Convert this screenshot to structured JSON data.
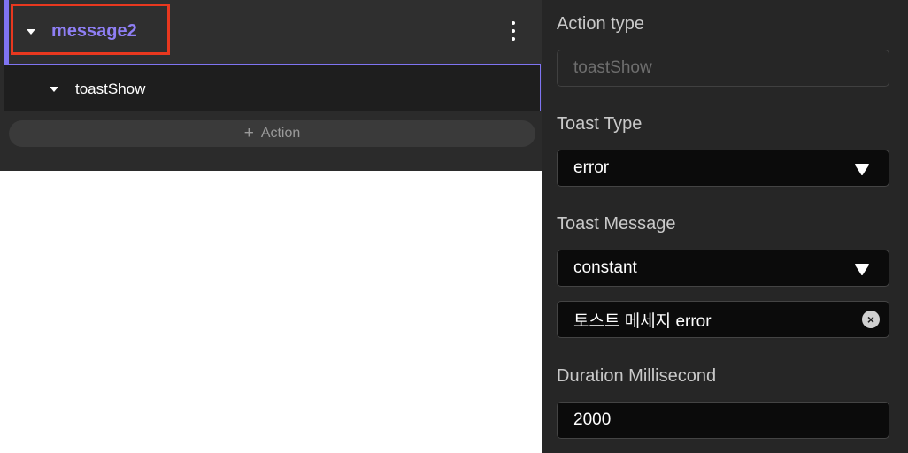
{
  "event": {
    "name": "message2",
    "menu_icon": "kebab-icon",
    "expand_icon": "caret-down-icon"
  },
  "action": {
    "name": "toastShow",
    "expand_icon": "caret-down-icon"
  },
  "add_action": {
    "plus": "+",
    "label": "Action"
  },
  "panel": {
    "action_type": {
      "label": "Action type",
      "value": "toastShow"
    },
    "toast_type": {
      "label": "Toast Type",
      "value": "error"
    },
    "toast_message": {
      "label": "Toast Message",
      "mode": "constant",
      "value": "토스트 메세지 error",
      "clear_icon": "clear-icon"
    },
    "duration": {
      "label": "Duration Millisecond",
      "value": "2000"
    }
  },
  "colors": {
    "accent": "#7f74f2",
    "highlight": "#e8381f",
    "event_name": "#8f7ff5"
  }
}
